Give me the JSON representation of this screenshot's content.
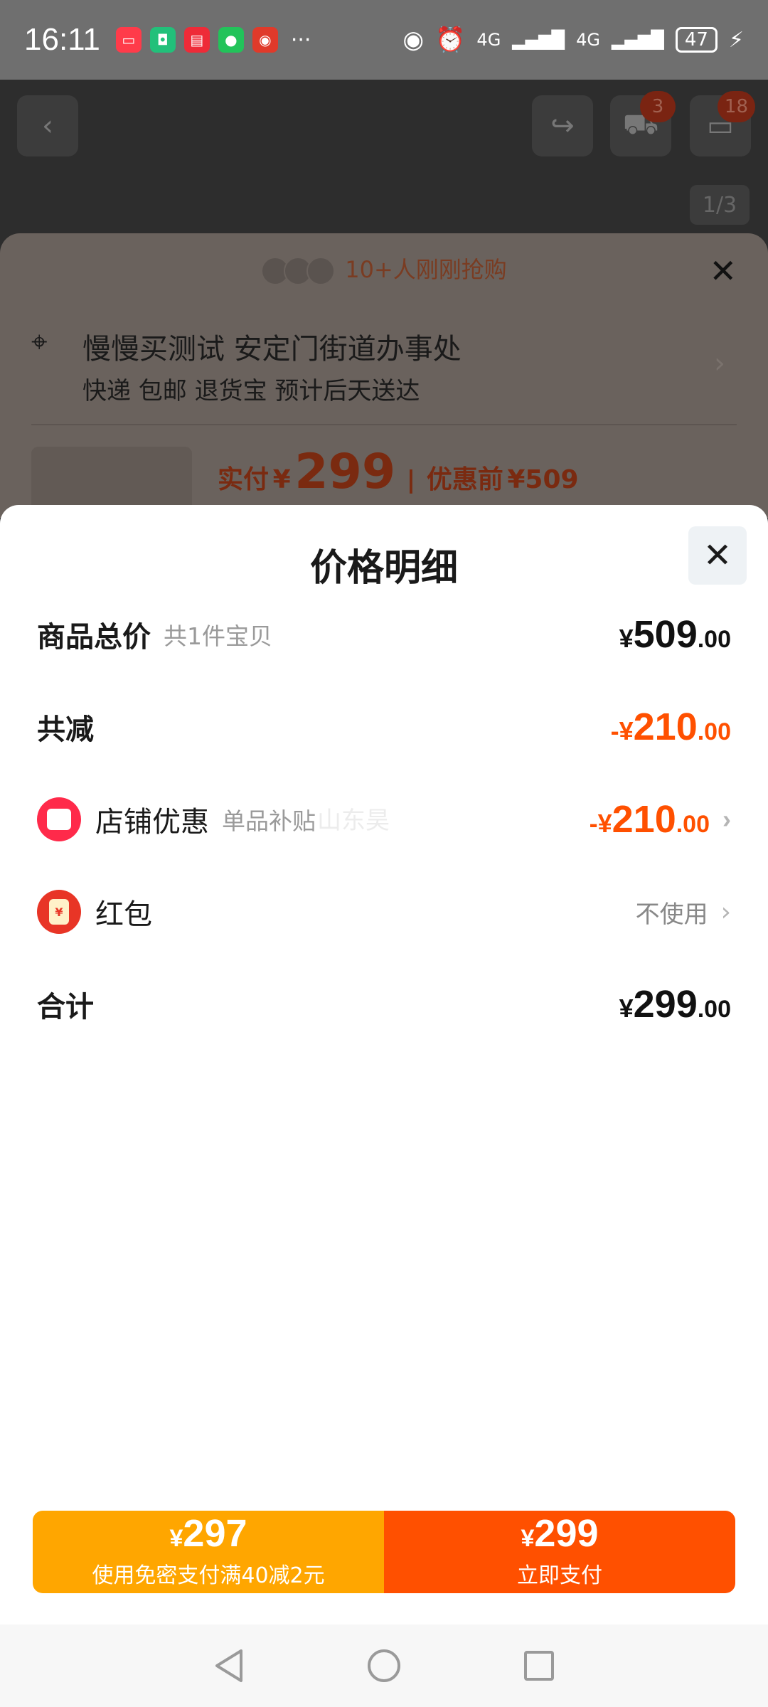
{
  "status_bar": {
    "time": "16:11",
    "more": "···",
    "network1": "4G",
    "network2": "4G",
    "battery": "47"
  },
  "background_page": {
    "cart_badge": "3",
    "message_badge": "18",
    "image_counter": "1/3",
    "buyers_text": "10+人刚刚抢购",
    "address_line1": "慢慢买测试 安定门街道办事处",
    "address_line2": "快递 包邮 退货宝 预计后天送达",
    "pay_label": "实付",
    "pay_currency": "¥",
    "pay_amount": "299",
    "before_label": "优惠前",
    "before_amount": "¥509"
  },
  "sheet": {
    "title": "价格明细",
    "rows": {
      "total": {
        "label": "商品总价",
        "sub": "共1件宝贝",
        "currency": "¥",
        "int": "509",
        "dec": ".00"
      },
      "reduce": {
        "label": "共减",
        "currency": "-¥",
        "int": "210",
        "dec": ".00"
      },
      "store": {
        "label": "店铺优惠",
        "sub": "单品补贴",
        "currency": "-¥",
        "int": "210",
        "dec": ".00"
      },
      "redpacket": {
        "label": "红包",
        "status": "不使用",
        "icon_text": "¥"
      },
      "sum": {
        "label": "合计",
        "currency": "¥",
        "int": "299",
        "dec": ".00"
      }
    },
    "watermark": "山东昊"
  },
  "pay_bar": {
    "left": {
      "currency": "¥",
      "amount": "297",
      "sub": "使用免密支付满40减2元"
    },
    "right": {
      "currency": "¥",
      "amount": "299",
      "sub": "立即支付"
    }
  },
  "colors": {
    "accent_orange": "#ff5000",
    "pay_yellow": "#ffa600",
    "store_icon": "#ff2a4a",
    "redpacket_icon": "#e83526"
  }
}
